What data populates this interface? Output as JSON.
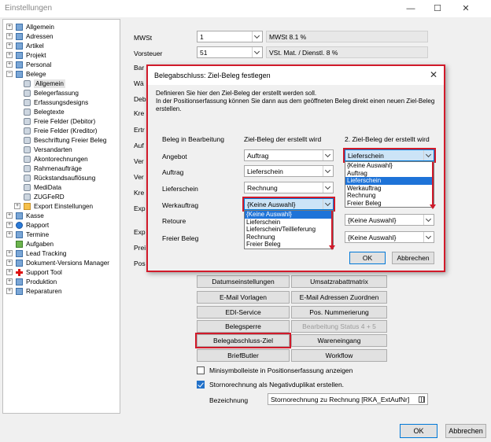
{
  "window": {
    "title": "Einstellungen",
    "minimize": "—",
    "maximize": "☐",
    "close": "✕"
  },
  "tree": [
    {
      "label": "Allgemein",
      "level": 0,
      "exp": "+",
      "icon": "pc"
    },
    {
      "label": "Adressen",
      "level": 0,
      "exp": "+",
      "icon": "pc"
    },
    {
      "label": "Artikel",
      "level": 0,
      "exp": "+",
      "icon": "pc"
    },
    {
      "label": "Projekt",
      "level": 0,
      "exp": "+",
      "icon": "pc"
    },
    {
      "label": "Personal",
      "level": 0,
      "exp": "+",
      "icon": "pc"
    },
    {
      "label": "Belege",
      "level": 0,
      "exp": "-",
      "icon": "pc"
    },
    {
      "label": "Allgemein",
      "level": 1,
      "icon": "cfg",
      "selected": true
    },
    {
      "label": "Belegerfassung",
      "level": 1,
      "icon": "cfg"
    },
    {
      "label": "Erfassungsdesigns",
      "level": 1,
      "icon": "cfg"
    },
    {
      "label": "Belegtexte",
      "level": 1,
      "icon": "cfg"
    },
    {
      "label": "Freie Felder (Debitor)",
      "level": 1,
      "icon": "cfg"
    },
    {
      "label": "Freie Felder (Kreditor)",
      "level": 1,
      "icon": "cfg"
    },
    {
      "label": "Beschriftung Freier Beleg",
      "level": 1,
      "icon": "cfg"
    },
    {
      "label": "Versandarten",
      "level": 1,
      "icon": "cfg"
    },
    {
      "label": "Akontorechnungen",
      "level": 1,
      "icon": "cfg"
    },
    {
      "label": "Rahmenaufträge",
      "level": 1,
      "icon": "cfg"
    },
    {
      "label": "Rückstandsauflösung",
      "level": 1,
      "icon": "cfg"
    },
    {
      "label": "MediData",
      "level": 1,
      "icon": "cfg"
    },
    {
      "label": "ZUGFeRD",
      "level": 1,
      "icon": "cfg"
    },
    {
      "label": "Export Einstellungen",
      "level": 1,
      "exp": "+",
      "icon": "folder"
    },
    {
      "label": "Kasse",
      "level": 0,
      "exp": "+",
      "icon": "pc"
    },
    {
      "label": "Rapport",
      "level": 0,
      "exp": "+",
      "icon": "blue"
    },
    {
      "label": "Termine",
      "level": 0,
      "exp": "+",
      "icon": "pc"
    },
    {
      "label": "Aufgaben",
      "level": 0,
      "exp": "",
      "icon": "green"
    },
    {
      "label": "Lead Tracking",
      "level": 0,
      "exp": "+",
      "icon": "pc"
    },
    {
      "label": "Dokument-Versions Manager",
      "level": 0,
      "exp": "+",
      "icon": "pc"
    },
    {
      "label": "Support Tool",
      "level": 0,
      "exp": "+",
      "icon": "cross"
    },
    {
      "label": "Produktion",
      "level": 0,
      "exp": "+",
      "icon": "pc"
    },
    {
      "label": "Reparaturen",
      "level": 0,
      "exp": "+",
      "icon": "pc"
    }
  ],
  "main": {
    "mwst_label": "MWSt",
    "mwst_value": "1",
    "mwst_desc": "MWSt 8.1 %",
    "vorsteuer_label": "Vorsteuer",
    "vorsteuer_value": "51",
    "vorsteuer_desc": "VSt. Mat. / Dienstl. 8 %",
    "partial_labels": [
      "Bar",
      "Wä",
      "Deb",
      "Kre",
      "Ertr",
      "Auf",
      "Ver",
      "Ver",
      "Kre",
      "Exp",
      "Exp",
      "Prei",
      "Pos"
    ],
    "buttons_left": [
      "Datumseinstellungen",
      "E-Mail Vorlagen",
      "EDI-Service",
      "Belegsperre",
      "Belegabschluss-Ziel",
      "BriefButler"
    ],
    "buttons_right": [
      "Umsatzrabattmatrix",
      "E-Mail Adressen Zuordnen",
      "Pos. Nummerierung",
      "Bearbeitung Status 4 + 5",
      "Wareneingang",
      "Workflow"
    ],
    "chk1_label": "Minisymbolleiste in Positionserfassung anzeigen",
    "chk2_label": "Stornorechnung als Negativduplikat erstellen.",
    "bezeichnung_label": "Bezeichnung",
    "bezeichnung_value": "Stornorechnung zu Rechnung [RKA_ExtAufNr]",
    "ok_label": "OK",
    "cancel_label": "Abbrechen"
  },
  "dialog": {
    "title": "Belegabschluss: Ziel-Beleg festlegen",
    "close": "✕",
    "desc1": "Definieren Sie hier den Ziel-Beleg der erstellt werden soll.",
    "desc2": "In der Positionserfassung können Sie dann aus dem geöffneten Beleg direkt einen neuen Ziel-Beleg erstellen.",
    "col1": "Beleg in Bearbeitung",
    "col2": "Ziel-Beleg der erstellt wird",
    "col3": "2. Ziel-Beleg der erstellt wird",
    "rows": [
      {
        "label": "Angebot",
        "ziel": "Auftrag"
      },
      {
        "label": "Auftrag",
        "ziel": "Lieferschein"
      },
      {
        "label": "Lieferschein",
        "ziel": "Rechnung"
      },
      {
        "label": "Werkauftrag",
        "ziel": "{Keine Auswahl}"
      },
      {
        "label": "Retoure",
        "ziel2": "{Keine Auswahl}"
      },
      {
        "label": "Freier Beleg",
        "ziel2": "{Keine Auswahl}"
      }
    ],
    "ziel2_selected": "Lieferschein",
    "list2_options": [
      "{Keine Auswahl}",
      "Auftrag",
      "Lieferschein",
      "Werkauftrag",
      "Rechnung",
      "Freier Beleg"
    ],
    "list2_selected_index": 2,
    "werk_list_options": [
      "{Keine Auswahl}",
      "Lieferschein",
      "Lieferschein/Teillieferung",
      "Rechnung",
      "Freier Beleg"
    ],
    "werk_list_selected_index": 0,
    "ok_label": "OK",
    "cancel_label": "Abbrechen"
  }
}
